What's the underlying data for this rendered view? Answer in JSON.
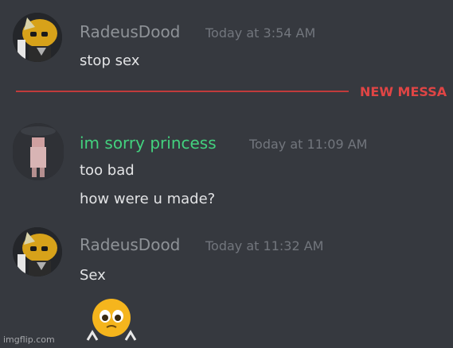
{
  "messages": [
    {
      "username": "RadeusDood",
      "timestamp": "Today at 3:54 AM",
      "lines": [
        "stop sex"
      ]
    },
    {
      "username": "im sorry princess",
      "timestamp": "Today at 11:09 AM",
      "lines": [
        "too bad",
        "how were u made?"
      ]
    },
    {
      "username": "RadeusDood",
      "timestamp": "Today at 11:32 AM",
      "lines": [
        "Sex"
      ]
    }
  ],
  "divider": {
    "label": "NEW MESSA"
  },
  "reaction": {
    "icon": "pleading-face-emoji-icon"
  },
  "watermark": "imgflip.com",
  "colors": {
    "background": "#36393f",
    "username_default": "#8e9297",
    "username_green": "#43d17e",
    "divider_red": "#e04545"
  }
}
